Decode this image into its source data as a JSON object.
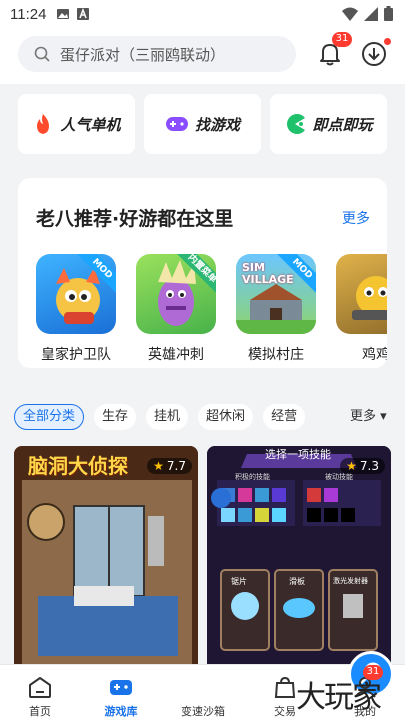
{
  "status_bar": {
    "time": "11:24"
  },
  "search": {
    "placeholder": "蛋仔派对（三丽鸥联动）"
  },
  "notifications": {
    "badge": "31"
  },
  "quick_buttons": [
    {
      "label": "人气单机",
      "icon": "flame-icon"
    },
    {
      "label": "找游戏",
      "icon": "gamepad-icon"
    },
    {
      "label": "即点即玩",
      "icon": "pacman-icon"
    }
  ],
  "recommend": {
    "title": "老八推荐·好游都在这里",
    "more": "更多",
    "games": [
      {
        "name": "皇家护卫队",
        "ribbon": "MOD"
      },
      {
        "name": "英雄冲刺",
        "ribbon": "内置菜单"
      },
      {
        "name": "模拟村庄",
        "ribbon": "MOD",
        "logo_text": "SIM VILLAGE"
      },
      {
        "name": "鸡鸡"
      }
    ]
  },
  "categories": {
    "items": [
      "全部分类",
      "生存",
      "挂机",
      "超休闲",
      "经营"
    ],
    "active": "全部分类",
    "more": "更多 ▾"
  },
  "tiles": [
    {
      "rating": "7.7",
      "banner": "脑洞大侦探"
    },
    {
      "rating": "7.3",
      "banner": "选择一项技能",
      "sub_left": "积极的技能",
      "sub_right": "被动技能",
      "cards": [
        "锯片",
        "滑板",
        "激光发射器"
      ]
    }
  ],
  "bottom_nav": {
    "items": [
      {
        "label": "首页"
      },
      {
        "label": "游戏库"
      },
      {
        "label": "变速沙箱"
      },
      {
        "label": "交易"
      },
      {
        "label": "我的"
      }
    ],
    "active": "游戏库",
    "badge": "31"
  },
  "watermark": "大玩家",
  "colors": {
    "accent": "#1a73e8",
    "badge": "#ff3b30"
  }
}
